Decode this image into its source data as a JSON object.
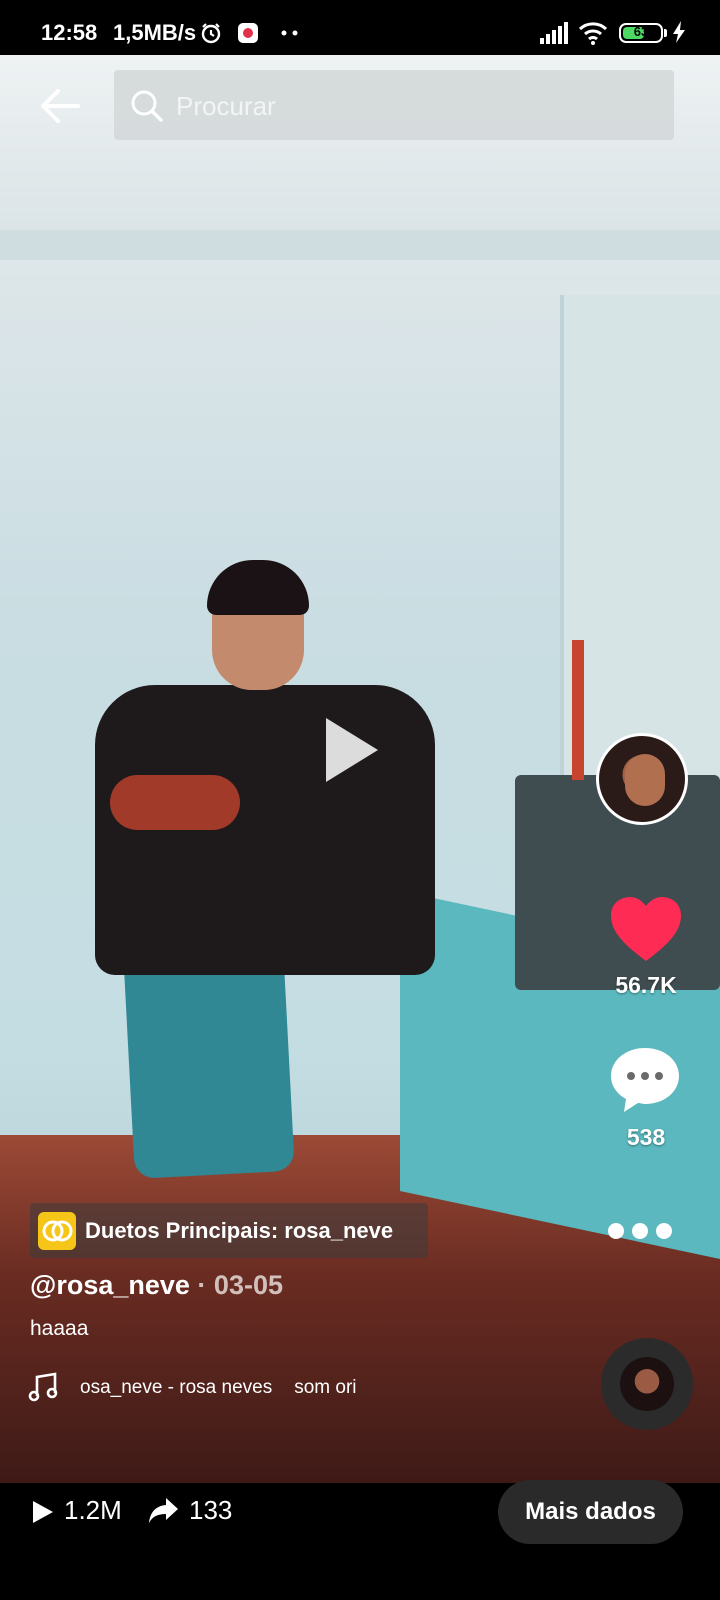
{
  "status_bar": {
    "time": "12:58",
    "network_speed": "1,5MB/s",
    "battery_level": "63",
    "battery_percent": 63,
    "icons": [
      "alarm-icon",
      "app-notification-icon",
      "more-dots-icon",
      "signal-icon",
      "wifi-icon",
      "battery-icon",
      "charging-icon"
    ]
  },
  "header": {
    "back_icon": "back-arrow-icon",
    "search_placeholder": "Procurar",
    "search_icon": "search-icon"
  },
  "video": {
    "play_icon": "play-icon"
  },
  "right_rail": {
    "like_count": "56.7K",
    "comment_count": "538",
    "like_color": "#fe2c55"
  },
  "post": {
    "duet_label": "Duetos Principais: rosa_neve",
    "author": "@rosa_neve",
    "date_separator": " · ",
    "date": "03-05",
    "caption": "haaaa",
    "music_text": "osa_neve - rosa neves",
    "music_text_2": "som ori"
  },
  "bottom_bar": {
    "play_count": "1.2M",
    "share_count": "133",
    "more_data_label": "Mais dados"
  }
}
